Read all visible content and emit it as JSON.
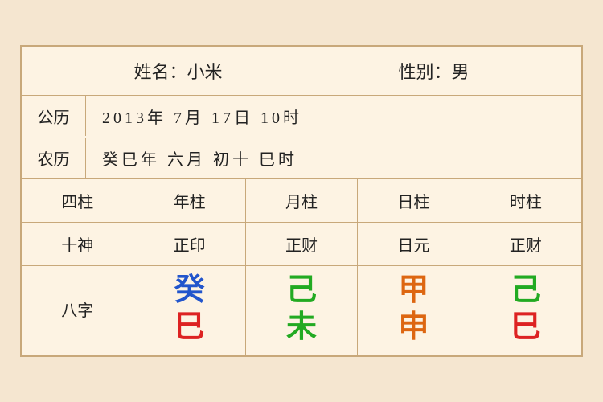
{
  "header": {
    "name_label": "姓名：小米",
    "gender_label": "性别：男"
  },
  "solar": {
    "label": "公历",
    "value": "2013年 7月 17日 10时"
  },
  "lunar": {
    "label": "农历",
    "value": "癸巳年 六月 初十 巳时"
  },
  "columns": {
    "headers": [
      "四柱",
      "年柱",
      "月柱",
      "日柱",
      "时柱"
    ],
    "shishen": [
      "十神",
      "正印",
      "正财",
      "日元",
      "正财"
    ],
    "bazhi_label": "八字"
  },
  "bazhi": {
    "nian": {
      "top": "癸",
      "bottom": "巳",
      "top_color": "blue",
      "bottom_color": "red"
    },
    "yue": {
      "top": "己",
      "bottom": "未",
      "top_color": "green",
      "bottom_color": "green"
    },
    "ri": {
      "top": "甲",
      "bottom": "申",
      "top_color": "orange",
      "bottom_color": "orange"
    },
    "shi": {
      "top": "己",
      "bottom": "巳",
      "top_color": "green",
      "bottom_color": "red"
    }
  }
}
